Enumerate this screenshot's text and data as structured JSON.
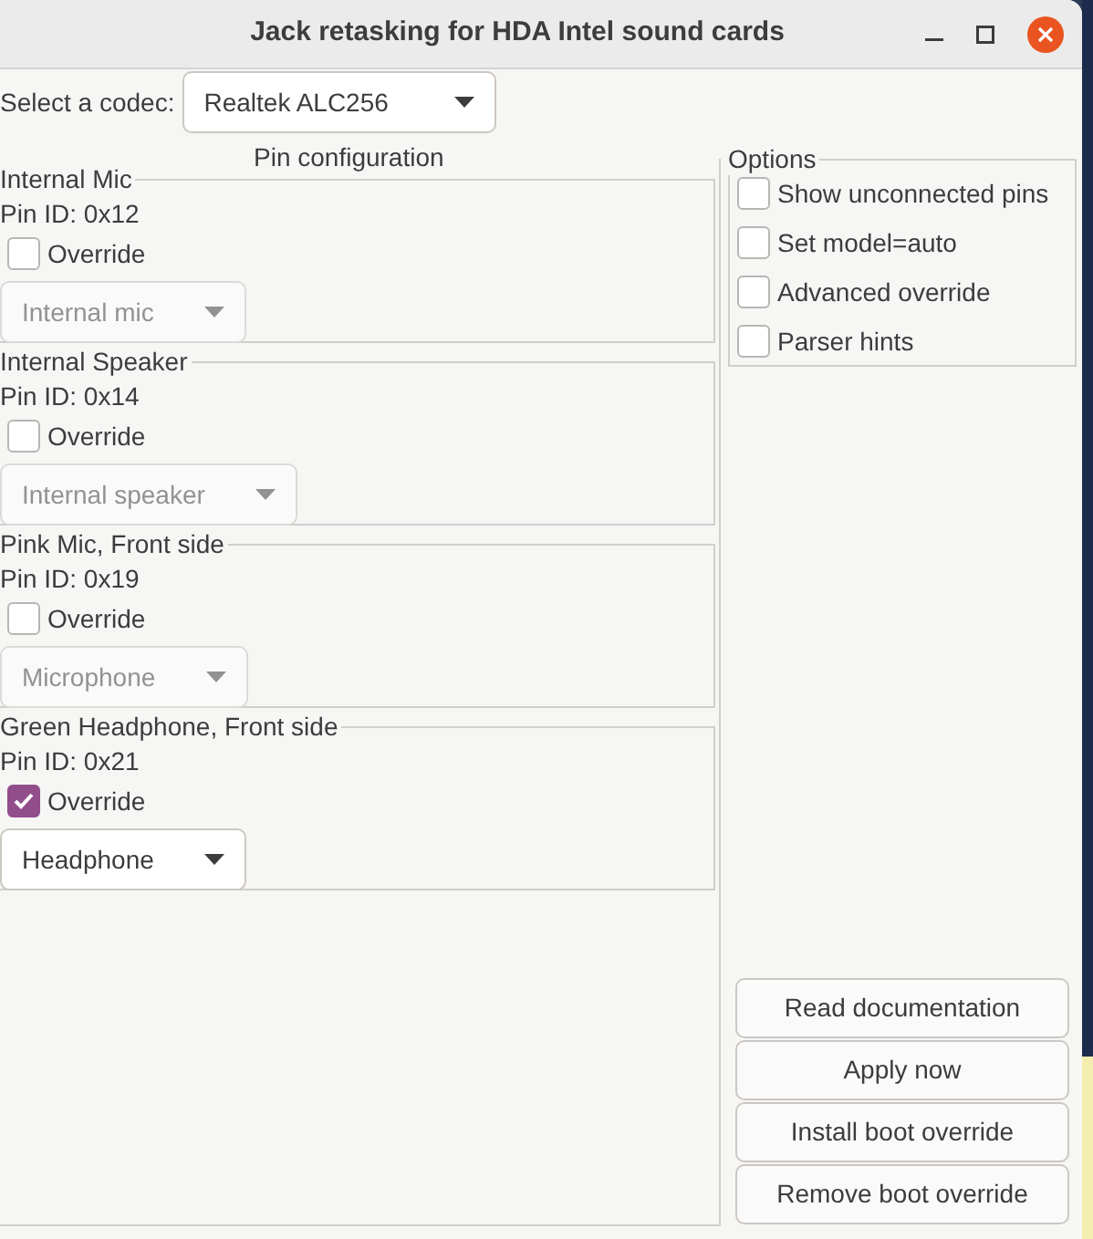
{
  "window": {
    "title": "Jack retasking for HDA Intel sound cards"
  },
  "codec": {
    "label": "Select a codec:",
    "value": "Realtek ALC256"
  },
  "pin_configuration": {
    "title": "Pin configuration",
    "pins": [
      {
        "name": "Internal Mic",
        "pin_id": "Pin ID: 0x12",
        "override_label": "Override",
        "checked": false,
        "value": "Internal mic"
      },
      {
        "name": "Internal Speaker",
        "pin_id": "Pin ID: 0x14",
        "override_label": "Override",
        "checked": false,
        "value": "Internal speaker"
      },
      {
        "name": "Pink Mic, Front side",
        "pin_id": "Pin ID: 0x19",
        "override_label": "Override",
        "checked": false,
        "value": "Microphone"
      },
      {
        "name": "Green Headphone, Front side",
        "pin_id": "Pin ID: 0x21",
        "override_label": "Override",
        "checked": true,
        "value": "Headphone"
      }
    ]
  },
  "options": {
    "title": "Options",
    "items": [
      {
        "label": "Show unconnected pins",
        "checked": false
      },
      {
        "label": "Set model=auto",
        "checked": false
      },
      {
        "label": "Advanced override",
        "checked": false
      },
      {
        "label": "Parser hints",
        "checked": false
      }
    ]
  },
  "buttons": [
    "Read documentation",
    "Apply now",
    "Install boot override",
    "Remove boot override"
  ]
}
